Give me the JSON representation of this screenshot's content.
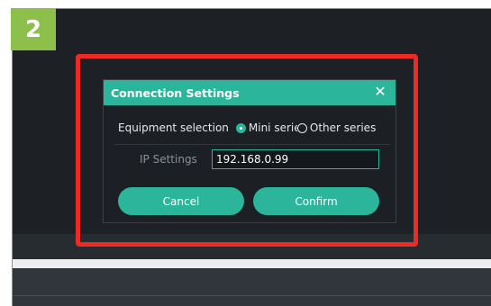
{
  "step": {
    "number": "2"
  },
  "colors": {
    "accent": "#2bb59a",
    "highlight": "#ee2a24",
    "badge": "#8cc04a",
    "background": "#1d2125"
  },
  "dialog": {
    "title": "Connection Settings",
    "close_icon": "close-icon",
    "equipment": {
      "label": "Equipment selection",
      "options": [
        {
          "label": "Mini series",
          "selected": true
        },
        {
          "label": "Other series",
          "selected": false
        }
      ]
    },
    "ip": {
      "label": "IP Settings",
      "value": "192.168.0.99"
    },
    "buttons": {
      "cancel": "Cancel",
      "confirm": "Confirm"
    }
  }
}
